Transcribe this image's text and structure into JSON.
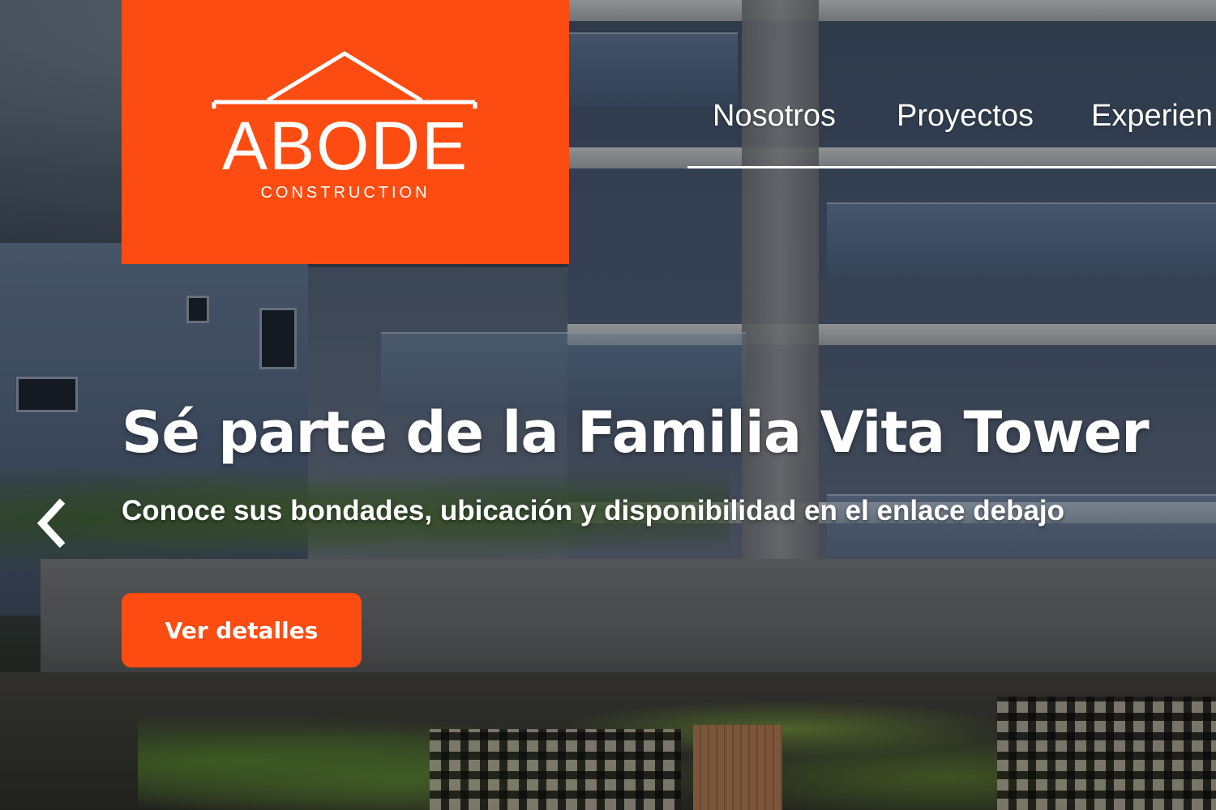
{
  "logo": {
    "name": "ABODE",
    "tagline": "CONSTRUCTION",
    "icon": "roof-icon",
    "background_color": "#fc4c12"
  },
  "nav": {
    "items": [
      {
        "label": "Nosotros"
      },
      {
        "label": "Proyectos"
      },
      {
        "label": "Experien"
      }
    ]
  },
  "hero": {
    "headline": "Sé parte de la Familia Vita Tower",
    "subheadline": "Conoce sus bondades, ubicación y disponibilidad en el enlace debajo",
    "cta_label": "Ver detalles",
    "prev_icon": "chevron-left-icon",
    "accent_color": "#fc4c12",
    "text_color": "#ffffff"
  }
}
